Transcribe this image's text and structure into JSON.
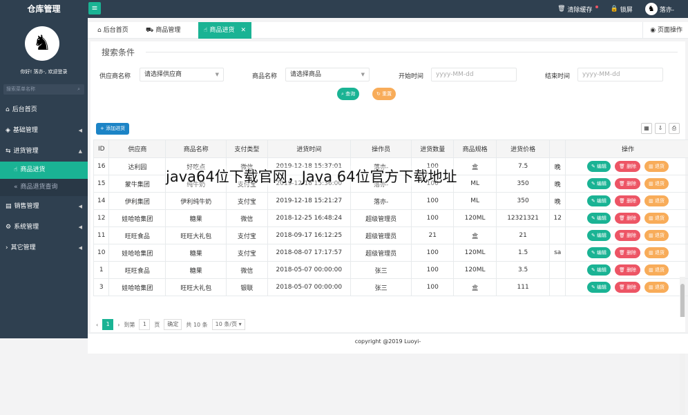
{
  "brand": "仓库管理",
  "topbar": {
    "clear_cache": "清除缓存",
    "lock": "锁屏",
    "user": "落亦-"
  },
  "profile": {
    "greeting": "你好! 落亦-, 欢迎登录"
  },
  "side_search": {
    "placeholder": "搜索菜单名称"
  },
  "nav": {
    "home": "后台首页",
    "basic": "基础管理",
    "purchase": "进货管理",
    "purchase_sub": [
      "商品进货",
      "商品退货查询"
    ],
    "sales": "销售管理",
    "system": "系统管理",
    "other": "其它管理"
  },
  "tabs": [
    "后台首页",
    "商品管理",
    "商品进货"
  ],
  "page_op": "页面操作",
  "search": {
    "title": "搜索条件",
    "supplier_label": "供应商名称",
    "supplier_value": "请选择供应商",
    "goods_label": "商品名称",
    "goods_value": "请选择商品",
    "start_label": "开始时间",
    "start_placeholder": "yyyy-MM-dd",
    "end_label": "结束时间",
    "end_placeholder": "yyyy-MM-dd",
    "query_btn": "查询",
    "reset_btn": "重置"
  },
  "add_btn": "添加进货",
  "columns": [
    "ID",
    "供应商",
    "商品名称",
    "支付类型",
    "进货时间",
    "操作员",
    "进货数量",
    "商品规格",
    "进货价格",
    "",
    "操作"
  ],
  "rows": [
    [
      "16",
      "达利园",
      "好吃点",
      "微信",
      "2019-12-18 15:37:01",
      "落亦-",
      "100",
      "盒",
      "7.5",
      "晚"
    ],
    [
      "15",
      "蒙牛集团",
      "纯牛奶",
      "支付宝",
      "2019-12-18 15:36:00",
      "落亦-",
      "100",
      "ML",
      "350",
      "晚"
    ],
    [
      "14",
      "伊利集团",
      "伊利纯牛奶",
      "支付宝",
      "2019-12-18 15:21:27",
      "落亦-",
      "100",
      "ML",
      "350",
      "晚"
    ],
    [
      "12",
      "娃哈哈集团",
      "糖果",
      "微信",
      "2018-12-25 16:48:24",
      "超级管理员",
      "100",
      "120ML",
      "12321321",
      "12"
    ],
    [
      "11",
      "旺旺食品",
      "旺旺大礼包",
      "支付宝",
      "2018-09-17 16:12:25",
      "超级管理员",
      "21",
      "盒",
      "21",
      ""
    ],
    [
      "10",
      "娃哈哈集团",
      "糖果",
      "支付宝",
      "2018-08-07 17:17:57",
      "超级管理员",
      "100",
      "120ML",
      "1.5",
      "sa"
    ],
    [
      "1",
      "旺旺食品",
      "糖果",
      "微信",
      "2018-05-07 00:00:00",
      "张三",
      "100",
      "120ML",
      "3.5",
      ""
    ],
    [
      "3",
      "娃哈哈集团",
      "旺旺大礼包",
      "银联",
      "2018-05-07 00:00:00",
      "张三",
      "100",
      "盒",
      "111",
      ""
    ]
  ],
  "ops": {
    "edit": "编辑",
    "delete": "删除",
    "return": "退货"
  },
  "pager": {
    "page": "1",
    "goto": "到第",
    "page_unit": "页",
    "confirm": "确定",
    "total": "共 10 条",
    "per_page": "10 条/页"
  },
  "footer": "copyright @2019 Luoyi-",
  "overlay_title": "java64位下载官网，Java 64位官方下载地址"
}
